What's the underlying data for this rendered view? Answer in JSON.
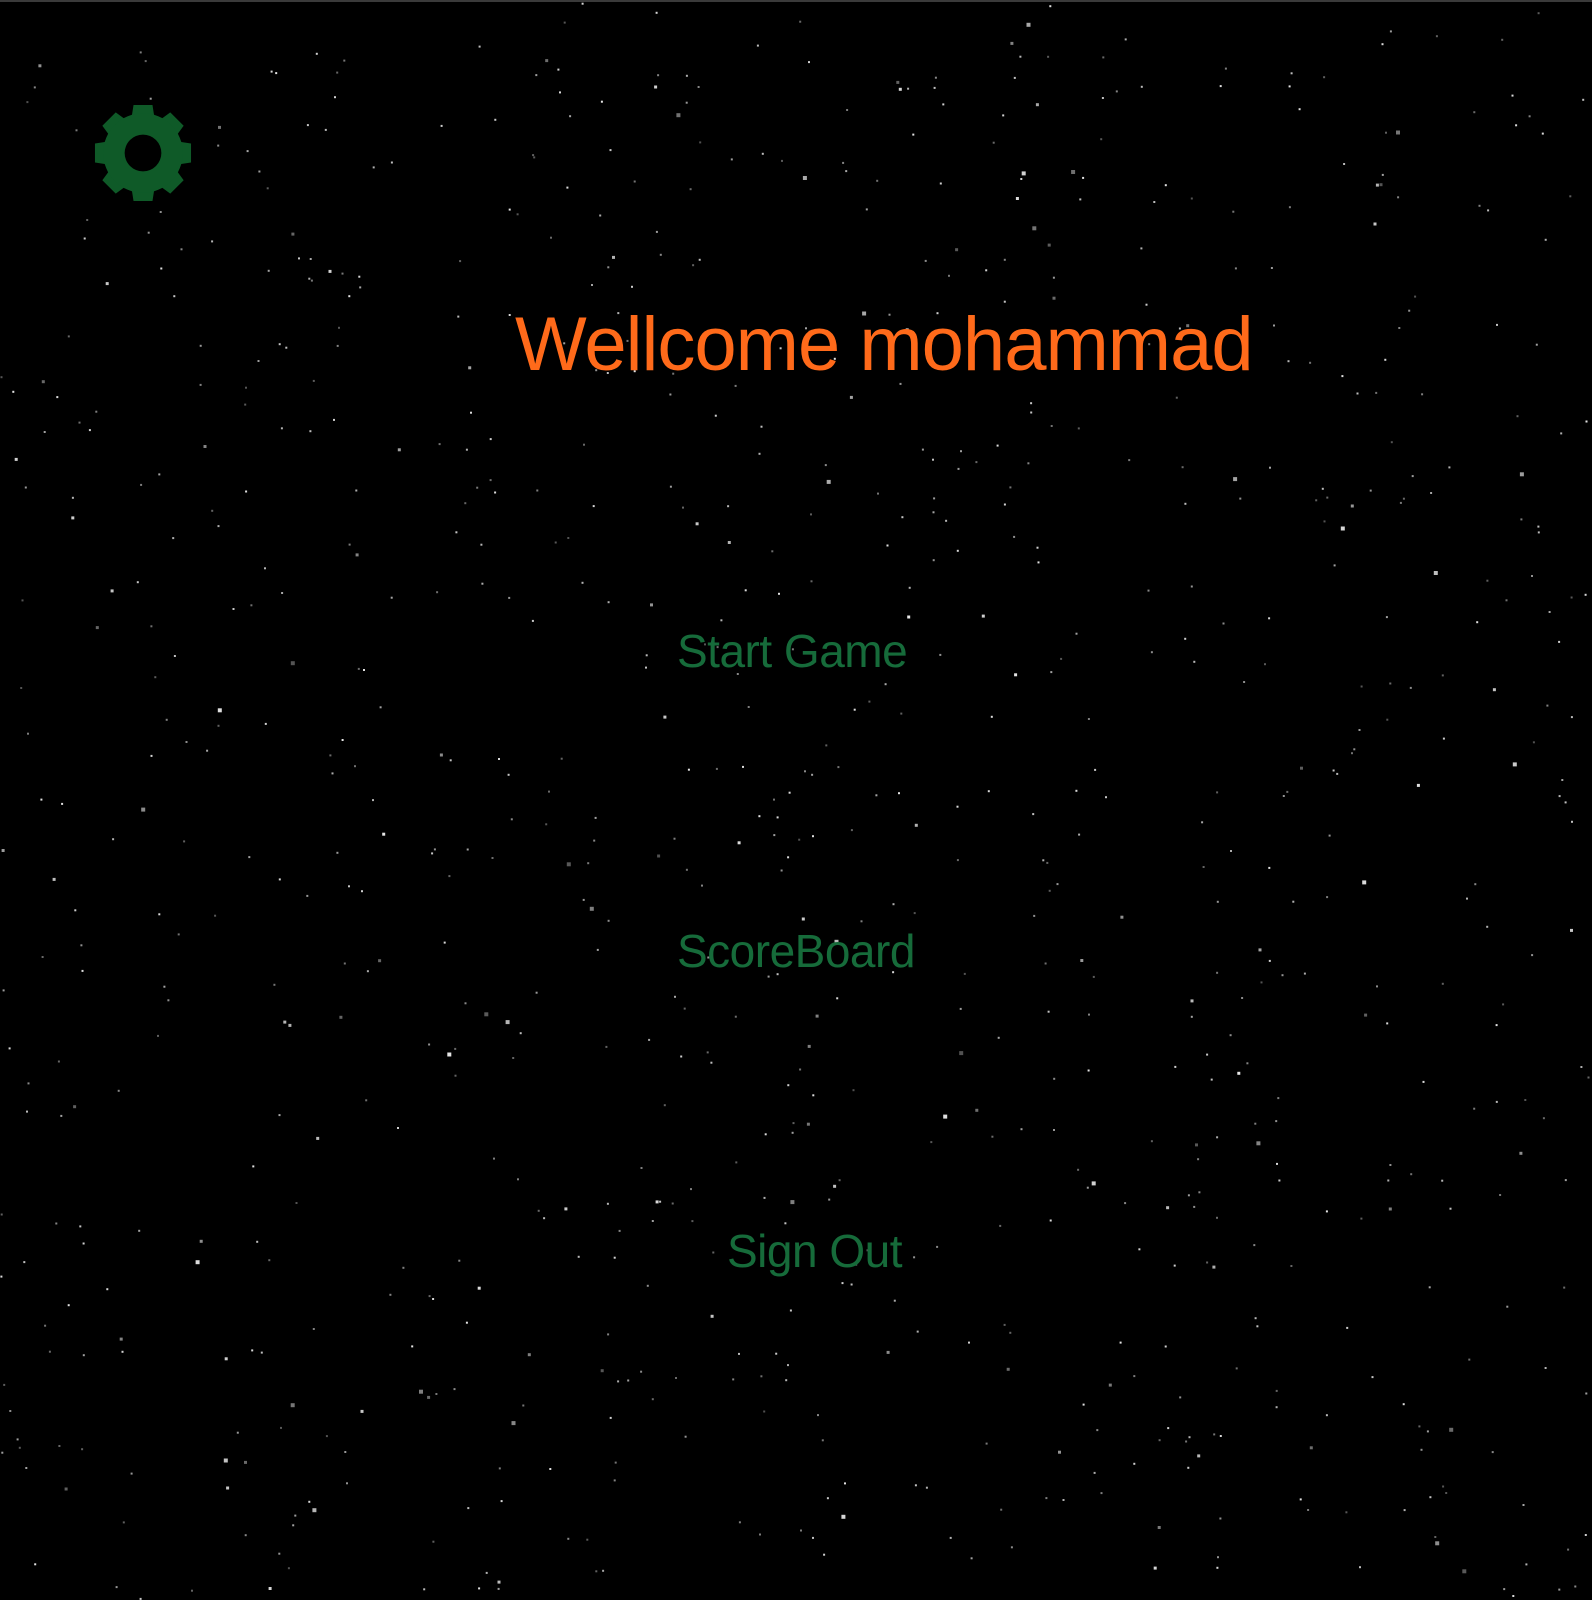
{
  "colors": {
    "background": "#000000",
    "title": "#ff6a1a",
    "menu": "#166b3a",
    "gear": "#0f5a28",
    "star": "#e8e8e8"
  },
  "header": {
    "settings_icon": "gear-icon"
  },
  "title": {
    "text": "Wellcome mohammad"
  },
  "menu": {
    "start_game": "Start Game",
    "scoreboard": "ScoreBoard",
    "sign_out": "Sign Out"
  }
}
